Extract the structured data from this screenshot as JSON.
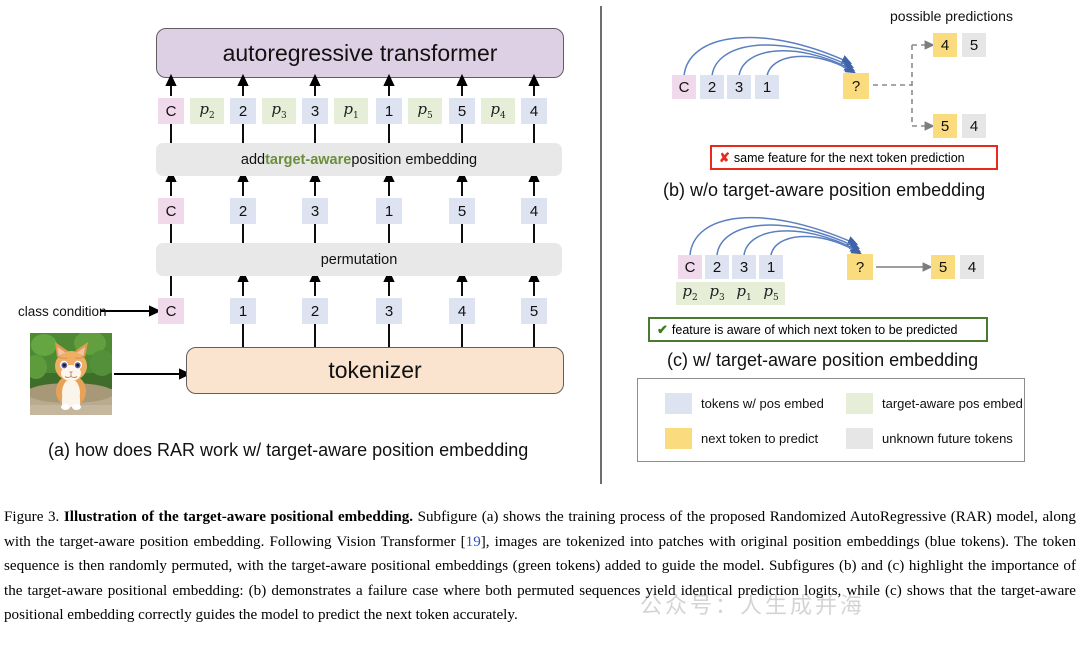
{
  "panel_a": {
    "transformer_label": "autoregressive transformer",
    "add_pe_bar": {
      "prefix": "add ",
      "highlight": "target-aware",
      "suffix": " position embedding"
    },
    "permutation_label": "permutation",
    "tokenizer_label": "tokenizer",
    "class_condition_label": "class condition",
    "caption": "(a) how does RAR work w/ target-aware position embedding",
    "row_embedded_tokens": [
      {
        "text": "C",
        "type": "pink"
      },
      {
        "text": "p2",
        "type": "green"
      },
      {
        "text": "2",
        "type": "blue"
      },
      {
        "text": "p3",
        "type": "green"
      },
      {
        "text": "3",
        "type": "blue"
      },
      {
        "text": "p1",
        "type": "green"
      },
      {
        "text": "1",
        "type": "blue"
      },
      {
        "text": "p5",
        "type": "green"
      },
      {
        "text": "5",
        "type": "blue"
      },
      {
        "text": "p4",
        "type": "green"
      },
      {
        "text": "4",
        "type": "blue"
      }
    ],
    "row_permuted_tokens": [
      {
        "text": "C",
        "type": "pink"
      },
      {
        "text": "2",
        "type": "blue"
      },
      {
        "text": "3",
        "type": "blue"
      },
      {
        "text": "1",
        "type": "blue"
      },
      {
        "text": "5",
        "type": "blue"
      },
      {
        "text": "4",
        "type": "blue"
      }
    ],
    "row_original_tokens": [
      {
        "text": "C",
        "type": "pink"
      },
      {
        "text": "1",
        "type": "blue"
      },
      {
        "text": "2",
        "type": "blue"
      },
      {
        "text": "3",
        "type": "blue"
      },
      {
        "text": "4",
        "type": "blue"
      },
      {
        "text": "5",
        "type": "blue"
      }
    ]
  },
  "panel_b": {
    "possible_predictions_label": "possible predictions",
    "context_tokens": [
      {
        "text": "C",
        "type": "pink"
      },
      {
        "text": "2",
        "type": "blue"
      },
      {
        "text": "3",
        "type": "blue"
      },
      {
        "text": "1",
        "type": "blue"
      }
    ],
    "query_token": {
      "text": "?",
      "type": "yellow"
    },
    "prediction_top": [
      {
        "text": "4",
        "type": "yellow"
      },
      {
        "text": "5",
        "type": "gray"
      }
    ],
    "prediction_bottom": [
      {
        "text": "5",
        "type": "yellow"
      },
      {
        "text": "4",
        "type": "gray"
      }
    ],
    "note": {
      "mark": "✘",
      "text": "same feature for the next token prediction"
    },
    "caption": "(b) w/o target-aware position embedding"
  },
  "panel_c": {
    "context_tokens": [
      {
        "text": "C",
        "type": "pink"
      },
      {
        "text": "2",
        "type": "blue"
      },
      {
        "text": "3",
        "type": "blue"
      },
      {
        "text": "1",
        "type": "blue"
      }
    ],
    "pos_tokens": [
      {
        "text": "p2",
        "type": "green"
      },
      {
        "text": "p3",
        "type": "green"
      },
      {
        "text": "p1",
        "type": "green"
      },
      {
        "text": "p5",
        "type": "green"
      }
    ],
    "query_token": {
      "text": "?",
      "type": "yellow"
    },
    "prediction": [
      {
        "text": "5",
        "type": "yellow"
      },
      {
        "text": "4",
        "type": "gray"
      }
    ],
    "note": {
      "mark": "✔",
      "text": "feature is aware of which next token to be predicted"
    },
    "caption": "(c) w/ target-aware position embedding"
  },
  "legend": {
    "items": [
      {
        "label": "tokens w/ pos embed",
        "color": "#dde3f0"
      },
      {
        "label": "target-aware pos embed",
        "color": "#e6eed8"
      },
      {
        "label": "next token to predict",
        "color": "#fadc7e"
      },
      {
        "label": "unknown future tokens",
        "color": "#e6e6e6"
      }
    ]
  },
  "figure_caption": {
    "number": "Figure 3.",
    "title": "Illustration of the target-aware positional embedding.",
    "body_1": " Subfigure (a) shows the training process of the proposed Randomized AutoRegressive (RAR) model, along with the target-aware position embedding. Following Vision Transformer [",
    "citation": "19",
    "body_2": "], images are tokenized into patches with original position embeddings (blue tokens). The token sequence is then randomly permuted, with the target-aware positional embeddings (green tokens) added to guide the model. Subfigures (b) and (c) highlight the importance of the target-aware positional embedding: (b) demonstrates a failure case where both permuted sequences yield identical prediction logits, while (c) shows that the target-aware positional embedding correctly guides the model to predict the next token accurately.",
    "watermark": "公众号：人生成并海"
  },
  "colors": {
    "blue_token": "#dde3f0",
    "pink_token": "#f0d9ea",
    "green_token": "#e6eed8",
    "yellow_token": "#fadc7e",
    "gray_token": "#e6e6e6",
    "transformer": "#ded0e4",
    "tokenizer": "#fbe4cf",
    "bar": "#e8e8e8",
    "accent_green": "#6a8f3c",
    "accent_red": "#e8291c",
    "arrow_blue": "#4a72b8",
    "citation": "#2b52c4"
  }
}
